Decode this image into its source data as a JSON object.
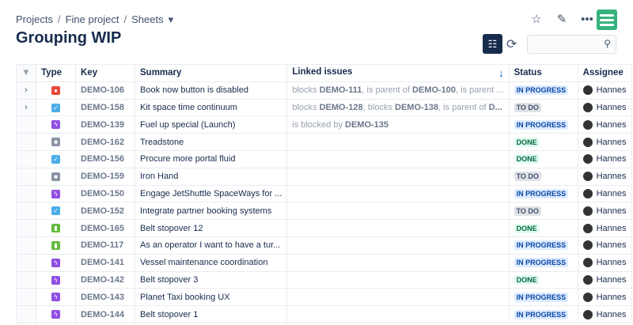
{
  "breadcrumb": [
    "Projects",
    "Fine project",
    "Sheets"
  ],
  "breadcrumb_dropdown": "▾",
  "title": "Grouping WIP",
  "columns": [
    "Type",
    "Key",
    "Summary",
    "Linked issues",
    "Status",
    "Assignee"
  ],
  "sort_indicator": "↓",
  "colors": {
    "bug": "#e5493a",
    "task": "#4bade8",
    "epic": "#904ee2",
    "subtask": "#8993a4",
    "story": "#63ba3c",
    "inprogress_bg": "#deebff",
    "inprogress_fg": "#0747a6",
    "todo_bg": "#dfe1e6",
    "todo_fg": "#42526e",
    "done_bg": "#e3fcef",
    "done_fg": "#006644"
  },
  "rows": [
    {
      "expand": "›",
      "type": "bug",
      "key": "DEMO-106",
      "summary": "Book now button is disabled",
      "linked": [
        [
          "blocks ",
          "DEMO-111"
        ],
        [
          ", is parent of ",
          "DEMO-100"
        ],
        [
          ", is parent ...",
          ""
        ]
      ],
      "status": "IN PROGRESS",
      "assignee": "Hannes"
    },
    {
      "expand": "›",
      "type": "task",
      "key": "DEMO-158",
      "summary": "Kit space time continuum",
      "linked": [
        [
          "blocks ",
          "DEMO-128"
        ],
        [
          ", blocks ",
          "DEMO-138"
        ],
        [
          ", is parent of ",
          "D..."
        ]
      ],
      "status": "TO DO",
      "assignee": "Hannes"
    },
    {
      "expand": "",
      "type": "epic",
      "key": "DEMO-139",
      "summary": "Fuel up special (Launch)",
      "linked": [
        [
          "is blocked by ",
          "DEMO-135"
        ]
      ],
      "status": "IN PROGRESS",
      "assignee": "Hannes"
    },
    {
      "expand": "",
      "type": "subtask",
      "key": "DEMO-162",
      "summary": "Treadstone",
      "linked": [],
      "status": "DONE",
      "assignee": "Hannes"
    },
    {
      "expand": "",
      "type": "task",
      "key": "DEMO-156",
      "summary": "Procure more portal fluid",
      "linked": [],
      "status": "DONE",
      "assignee": "Hannes"
    },
    {
      "expand": "",
      "type": "subtask",
      "key": "DEMO-159",
      "summary": "Iron Hand",
      "linked": [],
      "status": "TO DO",
      "assignee": "Hannes"
    },
    {
      "expand": "",
      "type": "epic",
      "key": "DEMO-150",
      "summary": "Engage JetShuttle SpaceWays for ...",
      "linked": [],
      "status": "IN PROGRESS",
      "assignee": "Hannes"
    },
    {
      "expand": "",
      "type": "task",
      "key": "DEMO-152",
      "summary": "Integrate partner booking systems",
      "linked": [],
      "status": "TO DO",
      "assignee": "Hannes"
    },
    {
      "expand": "",
      "type": "story",
      "key": "DEMO-165",
      "summary": "Belt stopover 12",
      "linked": [],
      "status": "DONE",
      "assignee": "Hannes"
    },
    {
      "expand": "",
      "type": "story",
      "key": "DEMO-117",
      "summary": "As an operator I want to have a tur...",
      "linked": [],
      "status": "IN PROGRESS",
      "assignee": "Hannes"
    },
    {
      "expand": "",
      "type": "epic",
      "key": "DEMO-141",
      "summary": "Vessel maintenance coordination",
      "linked": [],
      "status": "IN PROGRESS",
      "assignee": "Hannes"
    },
    {
      "expand": "",
      "type": "epic",
      "key": "DEMO-142",
      "summary": "Belt stopover 3",
      "linked": [],
      "status": "DONE",
      "assignee": "Hannes"
    },
    {
      "expand": "",
      "type": "epic",
      "key": "DEMO-143",
      "summary": "Planet Taxi booking UX",
      "linked": [],
      "status": "IN PROGRESS",
      "assignee": "Hannes"
    },
    {
      "expand": "",
      "type": "epic",
      "key": "DEMO-144",
      "summary": "Belt stopover 1",
      "linked": [],
      "status": "IN PROGRESS",
      "assignee": "Hannes"
    }
  ]
}
